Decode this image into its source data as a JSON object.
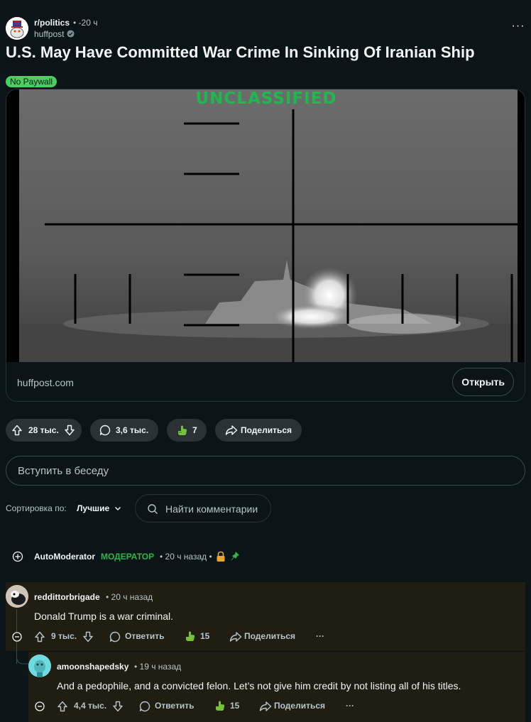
{
  "post": {
    "subreddit": "r/politics",
    "time": "• -20 ч",
    "author": "huffpost",
    "overflow": "···",
    "title": "U.S. May Have Committed War Crime In Sinking Of Iranian Ship",
    "flair": "No Paywall",
    "thumbnail_overlay": "UNCLASSIFIED",
    "link_domain": "huffpost.com",
    "open_label": "Открыть"
  },
  "actions": {
    "votes": "28 тыс.",
    "comments": "3,6 тыс.",
    "awards": "7",
    "share": "Поделиться"
  },
  "join": {
    "placeholder": "Вступить в беседу"
  },
  "sort": {
    "label": "Сортировка по:",
    "selected": "Лучшие",
    "search_placeholder": "Найти комментарии"
  },
  "automod": {
    "name": "AutoModerator",
    "role": "МОДЕРАТОР",
    "time": "• 20 ч назад •"
  },
  "comments": [
    {
      "user": "reddittorbrigade",
      "time": "• 20 ч назад",
      "body": "Donald Trump is a war criminal.",
      "votes": "9 тыс.",
      "reply": "Ответить",
      "awards": "15",
      "share": "Поделиться",
      "more": "···"
    },
    {
      "user": "amoonshapedsky",
      "time": "• 19 ч назад",
      "body": "And a pedophile, and a convicted felon. Let’s not give him credit by not listing all of his titles.",
      "votes": "4,4 тыс.",
      "reply": "Ответить",
      "awards": "15",
      "share": "Поделиться",
      "more": "···"
    }
  ],
  "colors": {
    "background": "#0b1416",
    "flair": "#46d160",
    "moderator": "#33b34a",
    "overlay_text": "#1fb84e",
    "highlight_comment": "#201d12"
  }
}
